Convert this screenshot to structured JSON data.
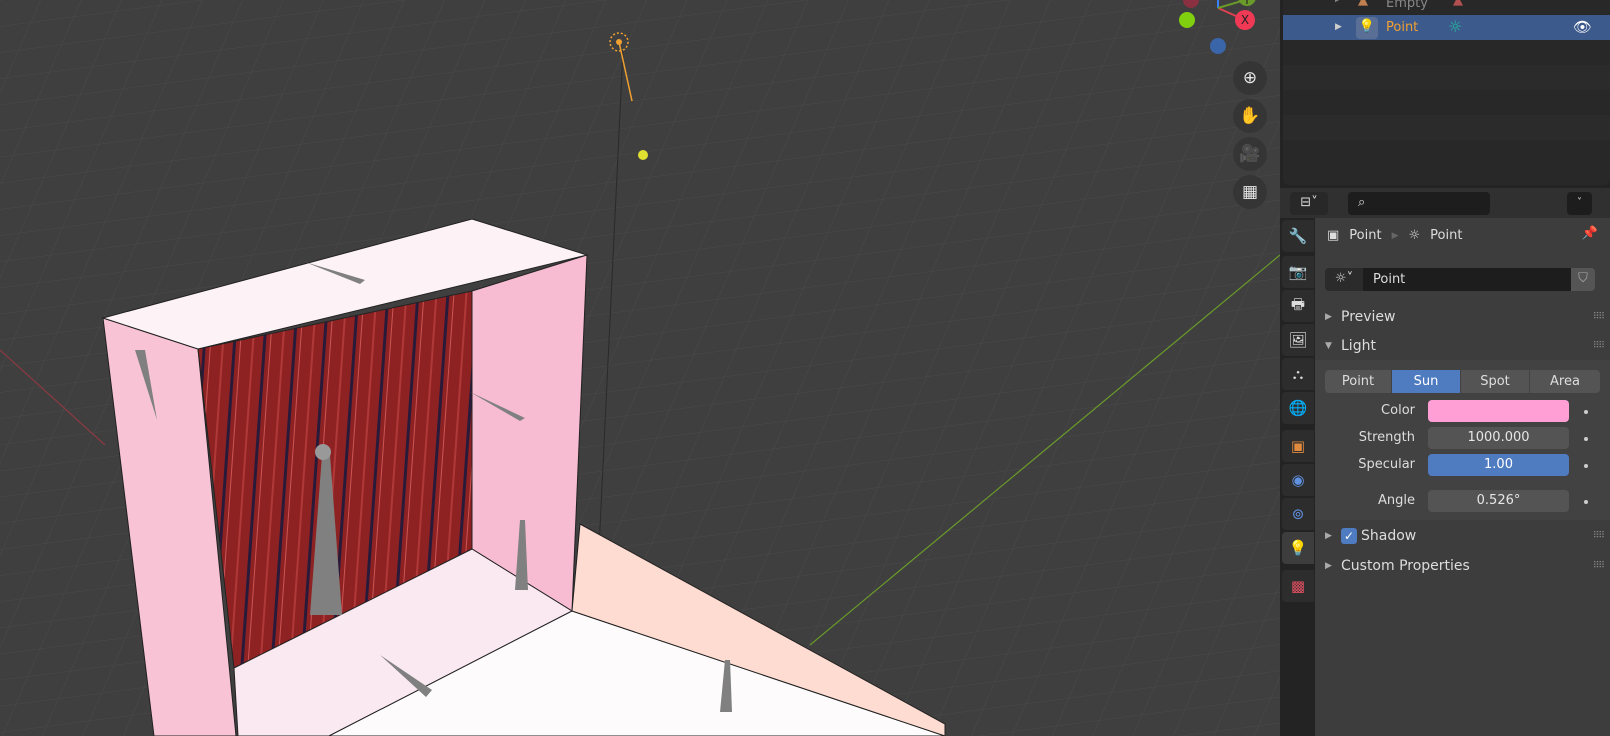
{
  "outliner": {
    "rows": [
      {
        "label": "Empty",
        "icon": "empty-icon"
      },
      {
        "label": "Point",
        "icon": "light-icon",
        "data_icon": "sun-icon",
        "selected": true
      }
    ]
  },
  "viewport": {
    "gizmo": {
      "x_label": "X",
      "y_label": "Y"
    },
    "nav": [
      "zoom-icon",
      "hand-icon",
      "camera-icon",
      "grid-icon"
    ]
  },
  "properties": {
    "search_placeholder": "",
    "breadcrumb": {
      "object": "Point",
      "data": "Point"
    },
    "datablock_name": "Point",
    "sections": {
      "preview": "Preview",
      "light": "Light",
      "shadow": "Shadow",
      "custom": "Custom Properties"
    },
    "light_types": [
      "Point",
      "Sun",
      "Spot",
      "Area"
    ],
    "active_type": "Sun",
    "fields": {
      "color_label": "Color",
      "color_value": "#ff9fd5",
      "strength_label": "Strength",
      "strength": "1000.000",
      "specular_label": "Specular",
      "specular": "1.00",
      "angle_label": "Angle",
      "angle": "0.526°"
    },
    "shadow_checked": true
  },
  "colors": {
    "accent": "#4f7bc0",
    "selected_row": "#3d5a8c",
    "light_orange": "#f0a030"
  }
}
